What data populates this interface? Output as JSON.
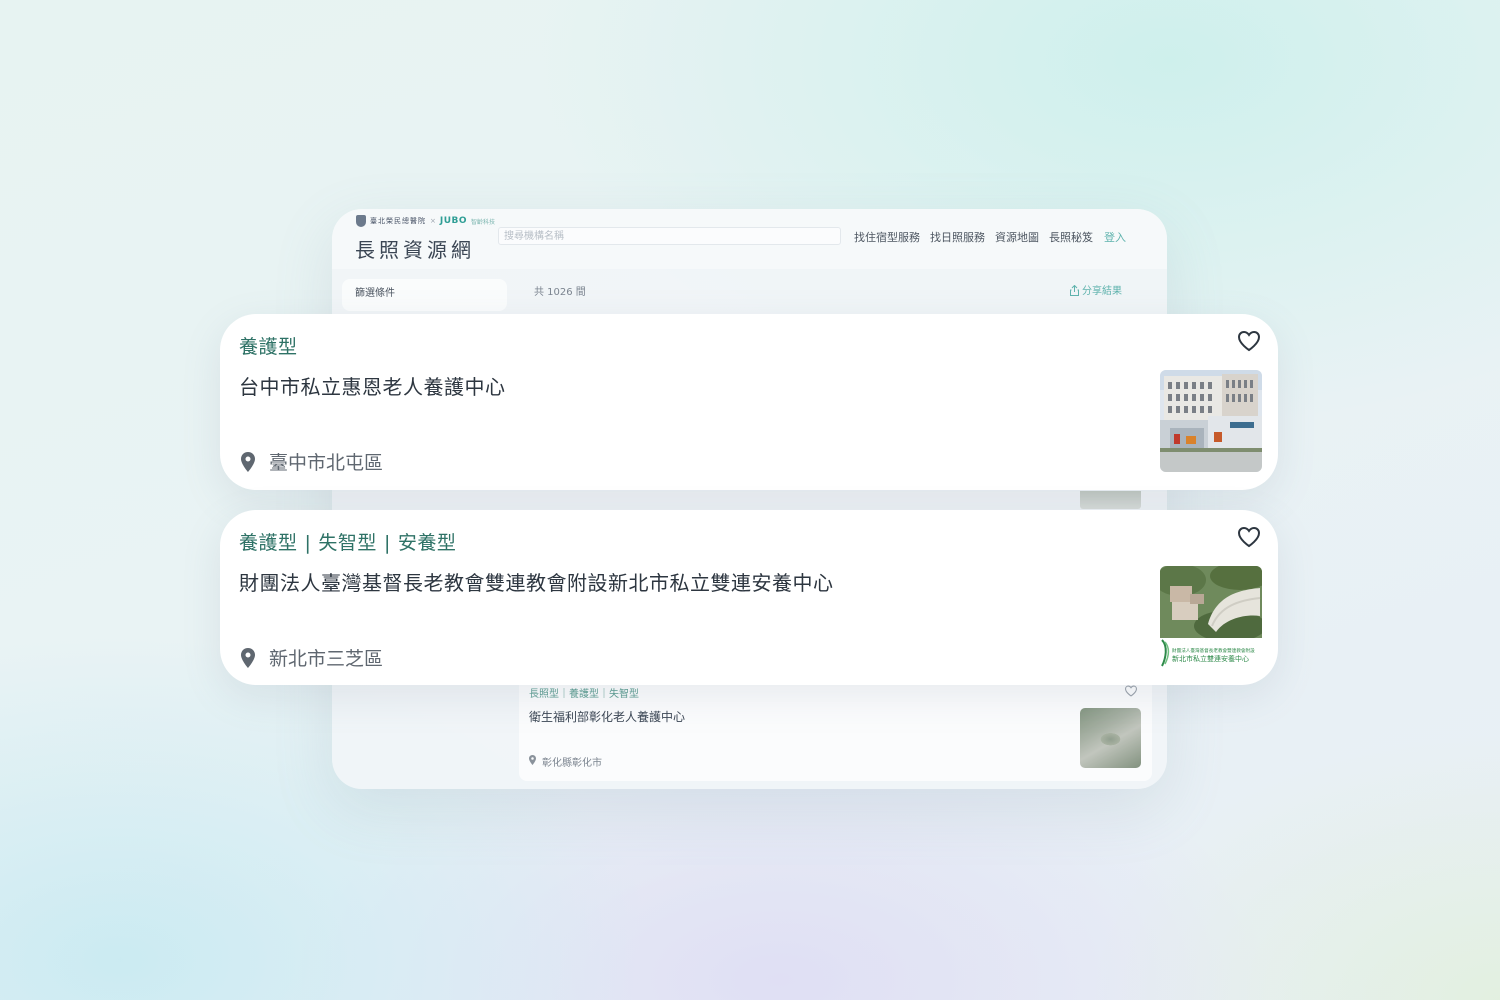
{
  "site": {
    "logo_small_text": "臺北榮民總醫院",
    "logo_x": "×",
    "logo_jubo": "JUBO",
    "logo_tail": "智齡科技",
    "title": "長照資源網",
    "search_placeholder": "搜尋機構名稱"
  },
  "nav": {
    "items": [
      "找住宿型服務",
      "找日照服務",
      "資源地圖",
      "長照秘笈"
    ],
    "login": "登入"
  },
  "filter": {
    "label": "篩選條件"
  },
  "results": {
    "count": "共 1026 間",
    "share": "分享結果"
  },
  "cards": [
    {
      "tags": [
        "養護型"
      ],
      "name": "台中市私立惠恩老人養護中心",
      "location": "臺中市北屯區"
    },
    {
      "tags": [
        "養護型",
        "失智型",
        "安養型"
      ],
      "name": "財團法人臺灣基督長老教會雙連教會附設新北市私立雙連安養中心",
      "location": "新北市三芝區",
      "image_caption_line1": "財團法人臺灣基督長老教會雙連教會附設",
      "image_caption_line2": "新北市私立雙連安養中心"
    }
  ],
  "list_item_3": {
    "tags": "長照型｜養護型｜失智型",
    "name": "衛生福利部彰化老人養護中心",
    "location": "彰化縣彰化市"
  },
  "colors": {
    "accent": "#2e7266",
    "teal_link": "#5fb3ad",
    "text_dark": "#2d3640",
    "text_muted": "#5f6770"
  },
  "icons": [
    "heart-icon",
    "location-pin-icon",
    "share-icon",
    "shield-logo-icon"
  ]
}
